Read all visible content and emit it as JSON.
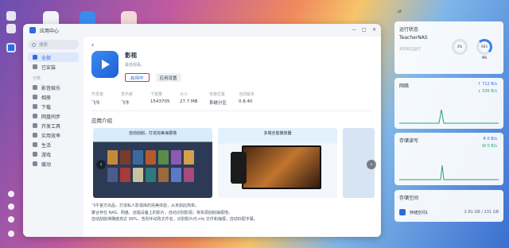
{
  "window": {
    "title": "应用中心",
    "controls": [
      "—",
      "□",
      "✕"
    ]
  },
  "sidebar": {
    "search_placeholder": "搜索",
    "items_top": [
      {
        "label": "全部",
        "active": true
      },
      {
        "label": "已安装",
        "active": false
      }
    ],
    "section_label": "分类",
    "items": [
      {
        "label": "影音娱乐"
      },
      {
        "label": "相册"
      },
      {
        "label": "下载"
      },
      {
        "label": "网盘同步"
      },
      {
        "label": "开发工具"
      },
      {
        "label": "实用效率"
      },
      {
        "label": "生活"
      },
      {
        "label": "游戏"
      },
      {
        "label": "缓动"
      }
    ]
  },
  "app": {
    "back_icon": "‹",
    "name": "影视",
    "subtitle": "最佳观看。",
    "open_button": "启用中",
    "settings_button": "应用设置",
    "info": [
      {
        "key": "开发者",
        "value": "飞牛"
      },
      {
        "key": "发布者",
        "value": "飞牛"
      },
      {
        "key": "下载量",
        "value": "1543705"
      },
      {
        "key": "大小",
        "value": "27.7 MB"
      },
      {
        "key": "安装位置",
        "value": "系统分区"
      },
      {
        "key": "当前版本",
        "value": "0.8.40"
      }
    ],
    "intro_title": "应用介绍",
    "gallery": [
      {
        "caption": "自动刮削，打造完美海报墙"
      },
      {
        "caption": "多端全能播放器"
      }
    ],
    "description": [
      "飞牛官方出品，打造私人影视库的完美体验，从未如此简单。",
      "聚合存在 NAS、网盘、远程设备上的影片，自动识别影视，将资源刮削海报墙，",
      "自动刮削准确度高达 99%，告别手动改文件名，识别影片内 nfo 文件和海报，自动匹配字幕。"
    ]
  },
  "widgets": {
    "header_icon": "⇄",
    "status": {
      "title": "运行状态",
      "host": "TeacherNAS",
      "uptime": "未开机已运行",
      "cpu_label": "CPU",
      "cpu_value": "3%",
      "ram_label": "内存",
      "ram_value": "603 MB"
    },
    "network": {
      "title": "网络",
      "up": "↑ 712 B/s",
      "down": "↓ 336 B/s",
      "color_up": "#2d6be5",
      "color_down": "#2fa36b"
    },
    "storage_rw": {
      "title": "存储读写",
      "read": "R 0 B/s",
      "write": "W 0 B/s"
    },
    "storage_space": {
      "title": "存储空间",
      "disk_label": "存储空间1",
      "disk_usage": "2.81 GB / 231 GB"
    }
  }
}
